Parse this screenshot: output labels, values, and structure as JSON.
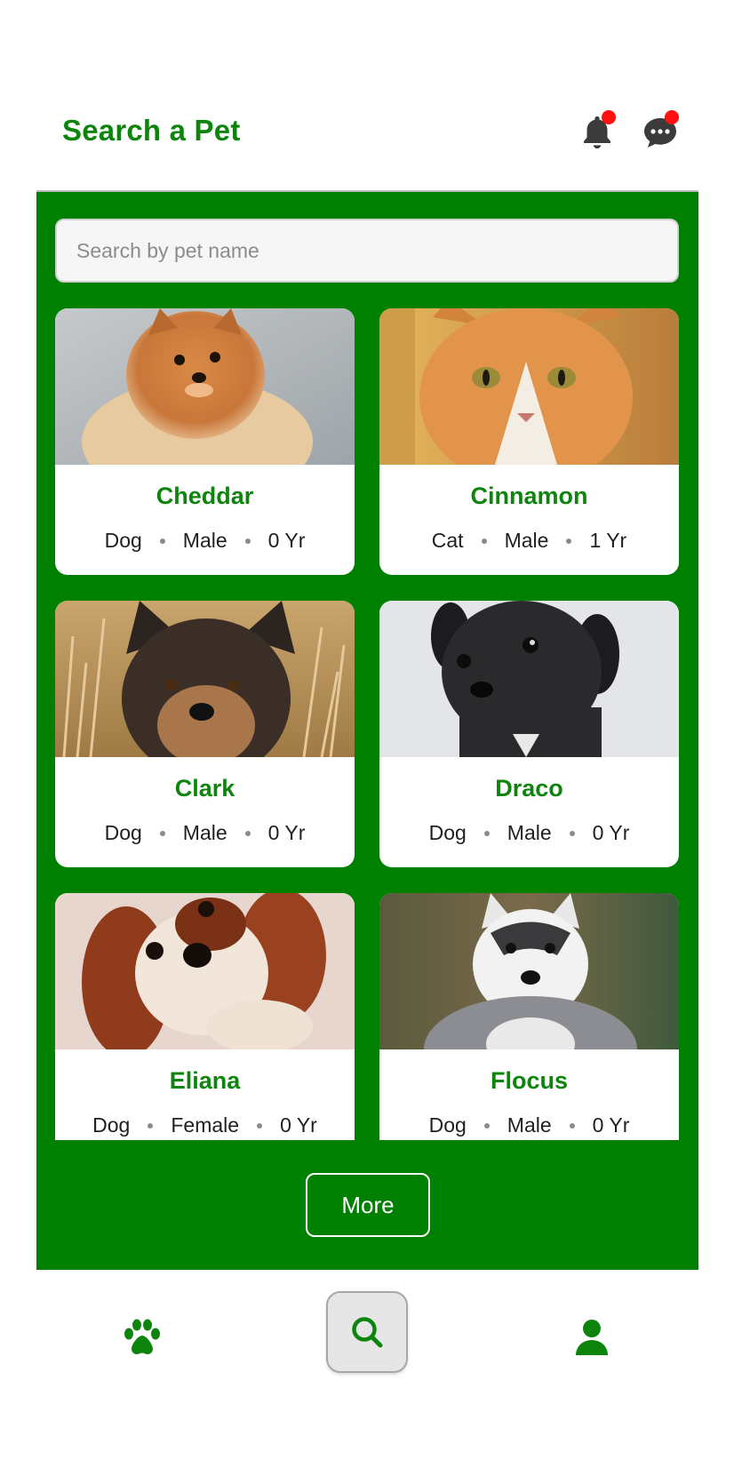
{
  "header": {
    "title": "Search a Pet"
  },
  "search": {
    "placeholder": "Search by pet name"
  },
  "pets": [
    {
      "name": "Cheddar",
      "species": "Dog",
      "gender": "Male",
      "age": "0 Yr"
    },
    {
      "name": "Cinnamon",
      "species": "Cat",
      "gender": "Male",
      "age": "1 Yr"
    },
    {
      "name": "Clark",
      "species": "Dog",
      "gender": "Male",
      "age": "0 Yr"
    },
    {
      "name": "Draco",
      "species": "Dog",
      "gender": "Male",
      "age": "0 Yr"
    },
    {
      "name": "Eliana",
      "species": "Dog",
      "gender": "Female",
      "age": "0 Yr"
    },
    {
      "name": "Flocus",
      "species": "Dog",
      "gender": "Male",
      "age": "0 Yr"
    }
  ],
  "more_label": "More",
  "tabs": [
    {
      "icon": "paw-icon"
    },
    {
      "icon": "search-icon",
      "active": true
    },
    {
      "icon": "user-icon"
    }
  ],
  "colors": {
    "brand_green": "#008000",
    "title_green": "#0d850d",
    "badge_red": "#ff1111"
  }
}
